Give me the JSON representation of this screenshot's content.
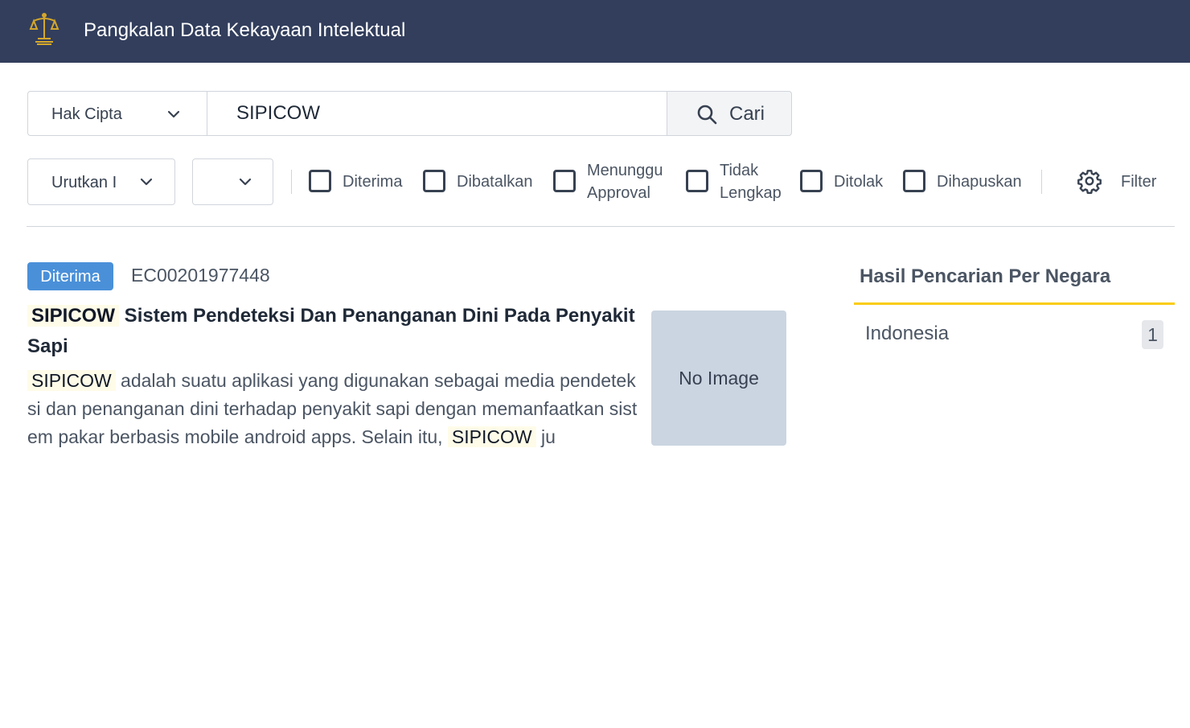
{
  "header": {
    "title": "Pangkalan Data Kekayaan Intelektual"
  },
  "search": {
    "type_selected": "Hak Cipta",
    "query": "SIPICOW",
    "button_label": "Cari"
  },
  "filters": {
    "sort_selected": "Urutkan I",
    "order_selected": "",
    "status_options": [
      {
        "label_line1": "Diterima",
        "label_line2": "",
        "checked": false
      },
      {
        "label_line1": "Dibatalkan",
        "label_line2": "",
        "checked": false
      },
      {
        "label_line1": "Menunggu",
        "label_line2": "Approval",
        "checked": false
      },
      {
        "label_line1": "Tidak",
        "label_line2": "Lengkap",
        "checked": false
      },
      {
        "label_line1": "Ditolak",
        "label_line2": "",
        "checked": false
      },
      {
        "label_line1": "Dihapuskan",
        "label_line2": "",
        "checked": false
      }
    ],
    "filter_label": "Filter"
  },
  "results": [
    {
      "status": "Diterima",
      "status_color": "#4a90d9",
      "registration_no": "EC00201977448",
      "title_highlight": "SIPICOW",
      "title_rest": " Sistem Pendeteksi Dan Penanganan Dini Pada Penyakit Sapi",
      "desc_highlight1": "SIPICOW",
      "desc_mid": " adalah suatu aplikasi yang digunakan sebagai media pendeteksi dan penanganan dini terhadap penyakit sapi dengan memanfaatkan sistem pakar berbasis mobile android apps. Selain itu, ",
      "desc_highlight2": "SIPICOW",
      "desc_end": " ju",
      "image_placeholder": "No Image"
    }
  ],
  "sidebar": {
    "title": "Hasil Pencarian Per Negara",
    "accent_color": "#facc15",
    "countries": [
      {
        "name": "Indonesia",
        "count": "1"
      }
    ]
  },
  "icons": {
    "logo": "justice-scales-logo-icon",
    "search": "search-icon",
    "dropdown": "chevron-down-icon",
    "settings": "gear-icon"
  }
}
